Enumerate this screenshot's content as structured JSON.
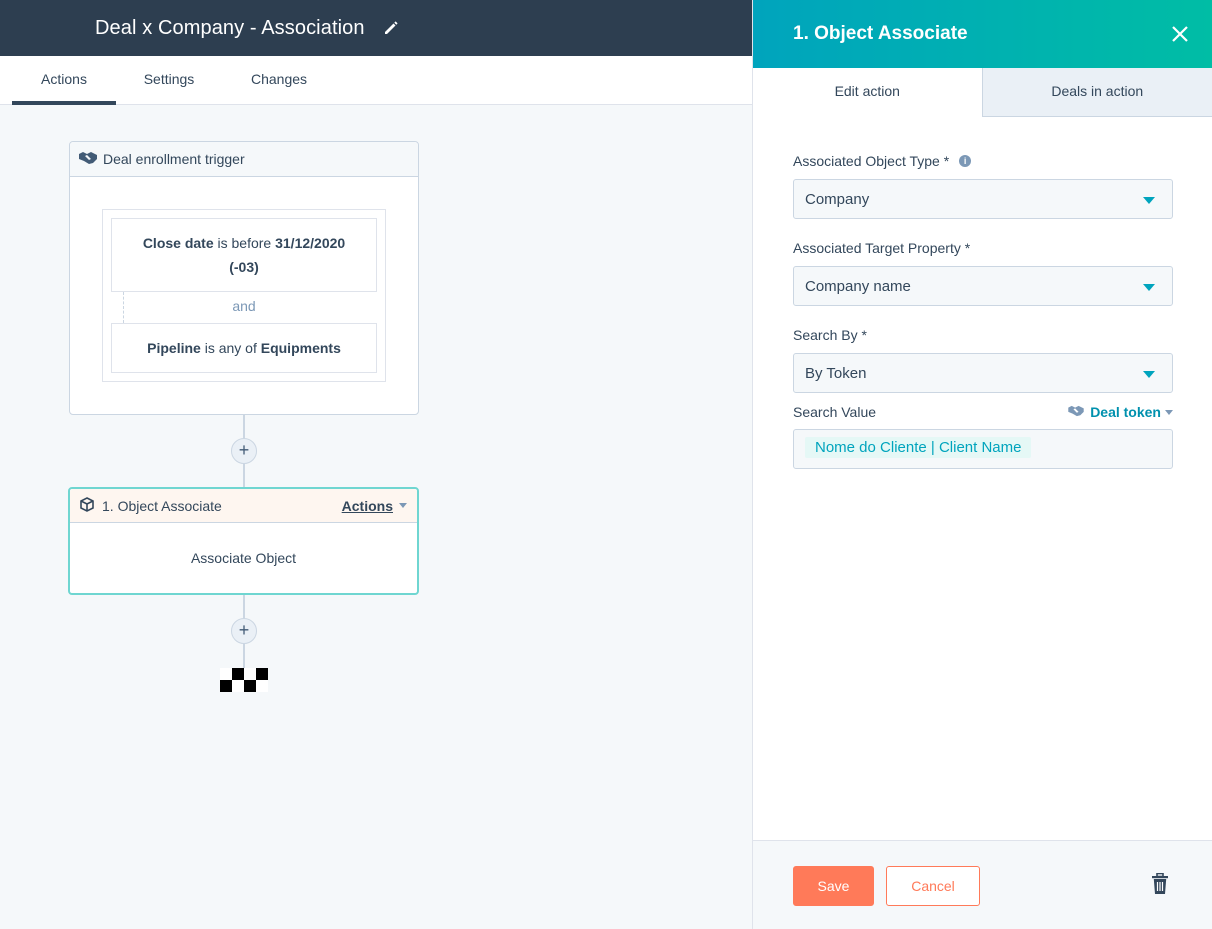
{
  "header": {
    "title": "Deal x Company - Association",
    "edit_icon": "pencil-icon"
  },
  "tabs": [
    {
      "label": "Actions",
      "active": true
    },
    {
      "label": "Settings",
      "active": false
    },
    {
      "label": "Changes",
      "active": false
    }
  ],
  "workflow": {
    "trigger": {
      "title": "Deal enrollment trigger",
      "icon": "handshake-icon",
      "filter1": {
        "property": "Close date",
        "operator": "is before",
        "value": "31/12/2020",
        "value2": "(-03)"
      },
      "joiner": "and",
      "filter2": {
        "property": "Pipeline",
        "operator": "is any of",
        "value": "Equipments"
      }
    },
    "plus": "+",
    "action": {
      "title": "1. Object Associate",
      "icon": "cube-icon",
      "actions_label": "Actions",
      "body": "Associate Object"
    },
    "end_icon": "checkered-flag-icon"
  },
  "panel": {
    "title": "1. Object Associate",
    "close_icon": "close-icon",
    "tabs": [
      {
        "label": "Edit action",
        "active": true
      },
      {
        "label": "Deals in action",
        "active": false
      }
    ],
    "fields": {
      "object_type": {
        "label": "Associated Object Type *",
        "value": "Company",
        "info_icon": "info-icon"
      },
      "target_property": {
        "label": "Associated Target Property *",
        "value": "Company name"
      },
      "search_by": {
        "label": "Search By *",
        "value": "By Token"
      },
      "search_value": {
        "label": "Search Value",
        "token_link": "Deal token",
        "token": "Nome do Cliente | Client Name"
      }
    },
    "footer": {
      "save": "Save",
      "cancel": "Cancel",
      "delete_icon": "trash-icon"
    }
  },
  "colors": {
    "header_bg": "#2d3e50",
    "accent_teal": "#00a4bd",
    "save_orange": "#ff7a59"
  }
}
